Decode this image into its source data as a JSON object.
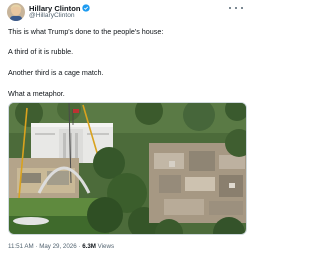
{
  "author": {
    "name": "Hillary Clinton",
    "handle": "@HillaryClinton",
    "verified": true,
    "avatar_icon": "avatar-photo"
  },
  "tweet": {
    "lines": [
      "This is what Trump's done to the people's house:",
      "A third of it is rubble.",
      "Another third is a cage match.",
      "What a metaphor."
    ]
  },
  "media": {
    "type": "aerial-photo",
    "subject": "White House under construction"
  },
  "meta": {
    "time": "11:51 AM",
    "separator1": " · ",
    "date": "May 29, 2026",
    "separator2": " · ",
    "views_count": "6.3M",
    "views_label": " Views"
  },
  "colors": {
    "text": "#0f1419",
    "secondary": "#536471",
    "verified": "#1d9bf0"
  }
}
